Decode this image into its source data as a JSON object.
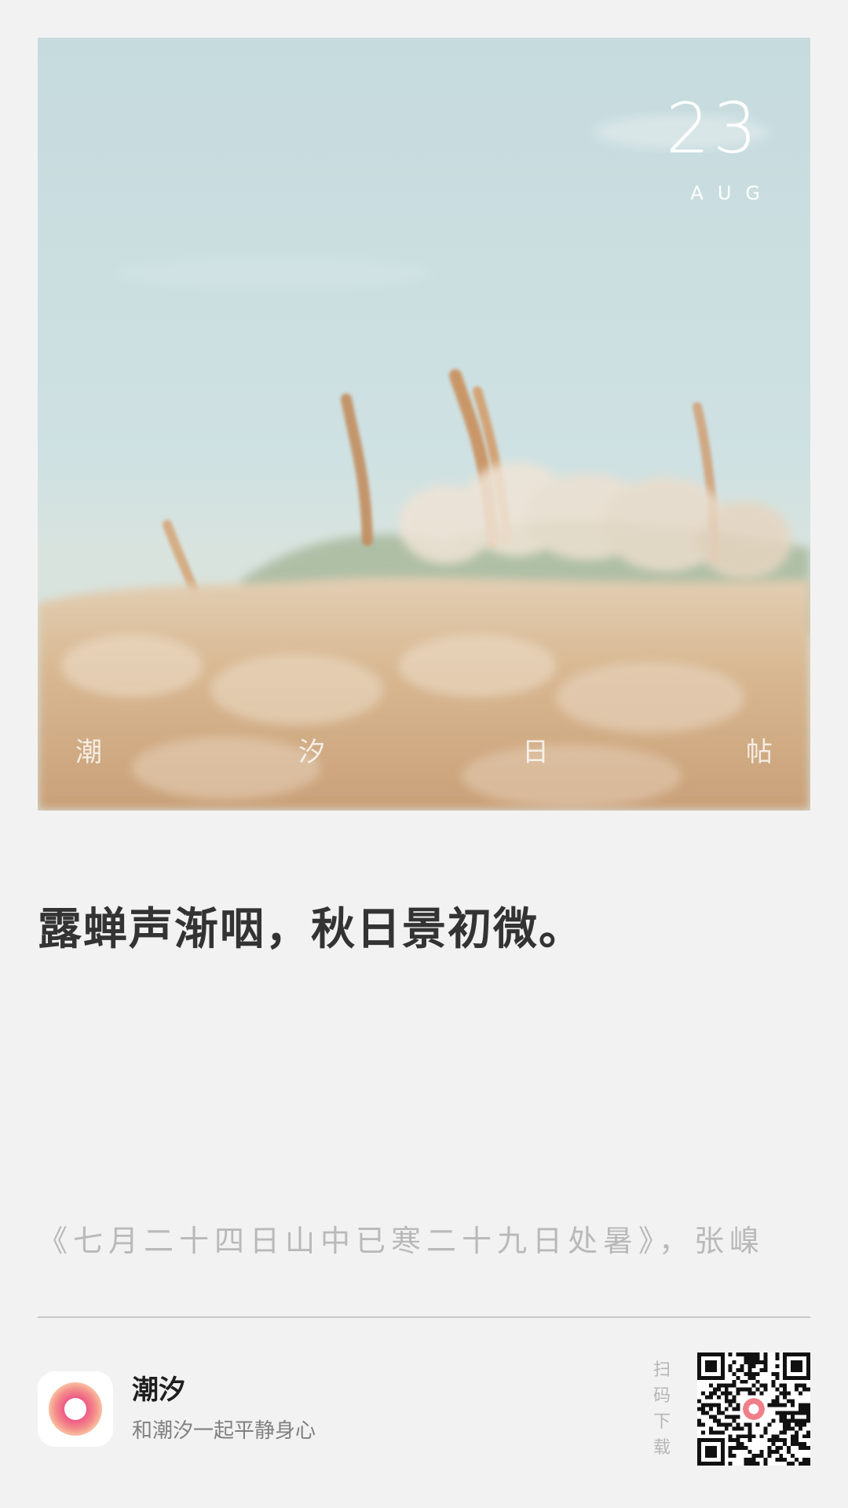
{
  "card": {
    "date": {
      "day": "23",
      "month": "AUG"
    },
    "brand_chars": [
      "潮",
      "汐",
      "日",
      "帖"
    ],
    "quote": "露蝉声渐咽，秋日景初微。",
    "source": "《七月二十四日山中已寒二十九日处暑》，张嵲"
  },
  "footer": {
    "app_name": "潮汐",
    "app_slogan": "和潮汐一起平静身心",
    "scan_label": "扫码下载"
  },
  "colors": {
    "background": "#f2f2f2",
    "sky": "#c7dcdf",
    "grass": "#d2b28e",
    "quote_text": "#333333",
    "source_text": "#b9b9b9",
    "icon_gradient_outer": "#f6a58a",
    "icon_gradient_inner": "#ec5f8a"
  },
  "icons": {
    "app_logo": "tide-ring-icon",
    "qr_code": "qr-code-icon"
  }
}
